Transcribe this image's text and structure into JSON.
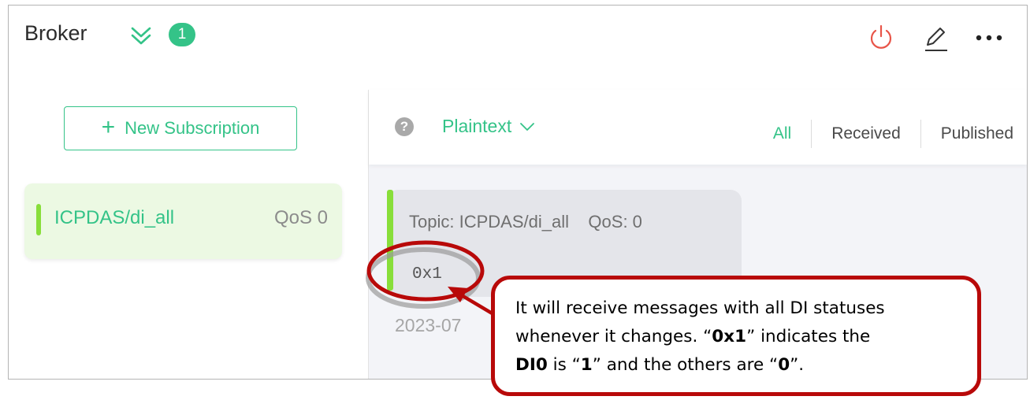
{
  "header": {
    "title": "Broker",
    "badge_count": "1",
    "icons": [
      "double-chevron-down-icon",
      "power-icon",
      "edit-icon",
      "more-icon"
    ],
    "accent_color": "#34c388",
    "power_color": "#e85448"
  },
  "sidebar": {
    "new_subscription_icon": "+",
    "new_subscription_label": "New Subscription",
    "subscriptions": [
      {
        "topic": "ICPDAS/di_all",
        "qos": "QoS 0",
        "color": "#88de3a"
      }
    ]
  },
  "toolbar": {
    "help_icon": "?",
    "format": "Plaintext",
    "filters": {
      "all": "All",
      "received": "Received",
      "published": "Published"
    },
    "active_filter": "All"
  },
  "messages": [
    {
      "topic_line": "Topic: ICPDAS/di_all    QoS: 0",
      "payload": "0x1",
      "time_partial": "2023-07"
    }
  ],
  "annotation": {
    "line1": "It will receive messages with all DI statuses",
    "line2_a": "whenever it changes. “",
    "line2_b": "0x1",
    "line2_c": "” indicates the",
    "line3_a": "DI0",
    "line3_b": " is “",
    "line3_c": "1",
    "line3_d": "” and the others are “",
    "line3_e": "0",
    "line3_f": "”.",
    "color": "#b80909"
  }
}
